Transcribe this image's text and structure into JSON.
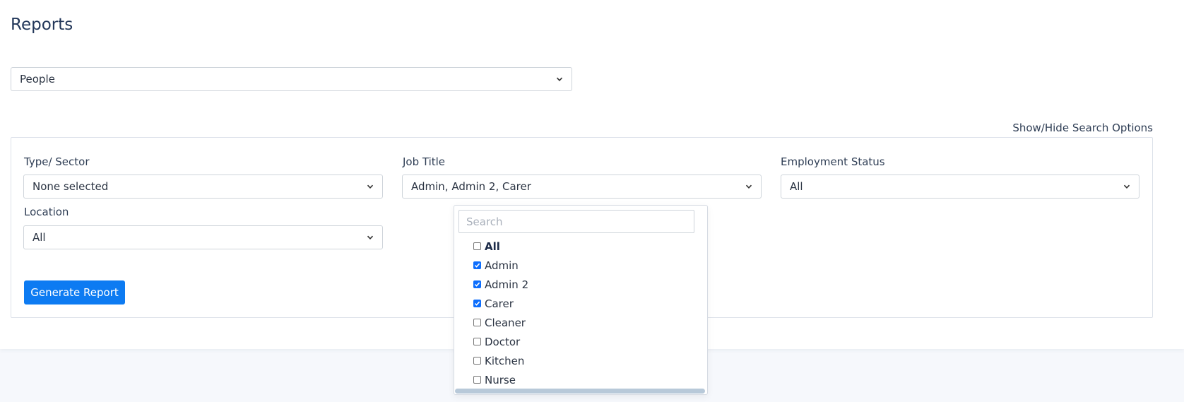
{
  "page": {
    "title": "Reports"
  },
  "report_type": {
    "value": "People"
  },
  "toggle_link": "Show/Hide Search Options",
  "filters": {
    "type_sector": {
      "label": "Type/ Sector",
      "value": "None selected"
    },
    "job_title": {
      "label": "Job Title",
      "value": "Admin, Admin 2, Carer"
    },
    "employment_status": {
      "label": "Employment Status",
      "value": "All"
    },
    "location": {
      "label": "Location",
      "value": "All"
    }
  },
  "generate_button": "Generate Report",
  "job_title_dropdown": {
    "search_placeholder": "Search",
    "options": [
      {
        "label": "All",
        "checked": false,
        "bold": true
      },
      {
        "label": "Admin",
        "checked": true,
        "bold": false
      },
      {
        "label": "Admin 2",
        "checked": true,
        "bold": false
      },
      {
        "label": "Carer",
        "checked": true,
        "bold": false
      },
      {
        "label": "Cleaner",
        "checked": false,
        "bold": false
      },
      {
        "label": "Doctor",
        "checked": false,
        "bold": false
      },
      {
        "label": "Kitchen",
        "checked": false,
        "bold": false
      },
      {
        "label": "Nurse",
        "checked": false,
        "bold": false
      }
    ]
  },
  "colors": {
    "primary": "#0d7bf2",
    "title": "#213659",
    "checkbox_checked": "#0d6efd"
  }
}
